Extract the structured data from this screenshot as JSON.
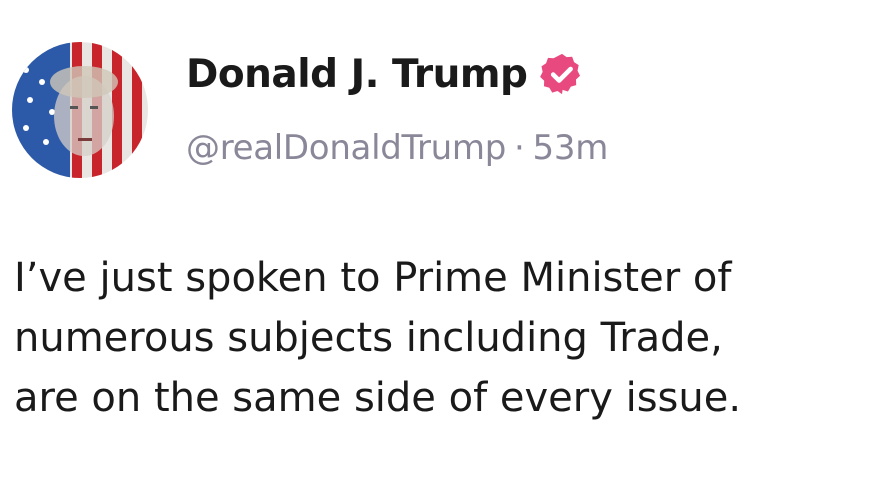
{
  "post": {
    "author": {
      "display_name": "Donald J. Trump",
      "handle": "@realDonaldTrump",
      "verified": true,
      "verified_badge_icon": "verified-checkmark-icon",
      "badge_color": "#e8497f"
    },
    "meta": {
      "separator": "·",
      "time_ago": "53m"
    },
    "body_lines": [
      "I’ve just spoken to Prime Minister of",
      "numerous subjects including Trade,",
      "are on the same side of every issue."
    ]
  },
  "colors": {
    "text_primary": "#1a1a1a",
    "text_secondary": "#8a8799",
    "background": "#ffffff"
  }
}
